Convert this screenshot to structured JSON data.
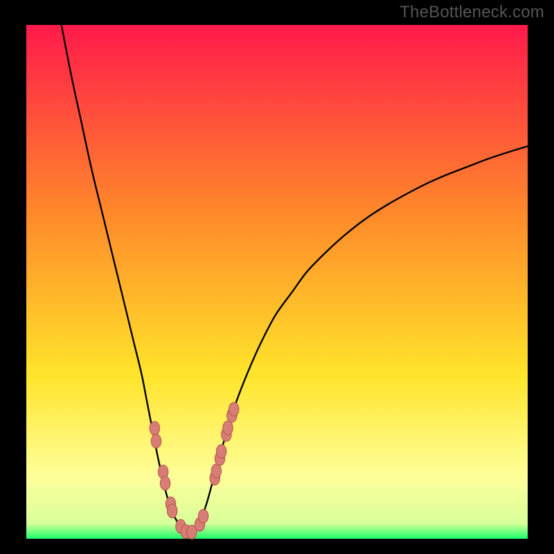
{
  "attribution": "TheBottleneck.com",
  "colors": {
    "frame": "#000000",
    "gradient_top": "#ff1a4b",
    "gradient_mid1": "#ff8a2a",
    "gradient_mid2": "#ffe42a",
    "gradient_mid3": "#ffff9a",
    "gradient_bottom": "#1cff6a",
    "curve": "#000000",
    "marker_fill": "#d77d75",
    "marker_stroke": "#b3554c"
  },
  "chart_data": {
    "type": "line",
    "title": "",
    "xlabel": "",
    "ylabel": "",
    "xlim": [
      0,
      100
    ],
    "ylim": [
      0,
      100
    ],
    "series": [
      {
        "name": "left-branch",
        "x": [
          7,
          9,
          11,
          13,
          15,
          17,
          18.5,
          20,
          21.5,
          23,
          24,
          25,
          26,
          27,
          28,
          29,
          30,
          31,
          32
        ],
        "values": [
          100,
          90,
          81,
          72,
          64,
          56,
          50,
          44,
          38,
          32,
          27,
          22,
          17,
          12.5,
          8.5,
          5.5,
          3.5,
          2,
          1.3
        ]
      },
      {
        "name": "right-branch",
        "x": [
          32,
          33,
          34,
          35,
          36,
          37,
          38,
          39,
          40,
          41,
          42,
          44,
          46,
          48,
          50,
          53,
          56,
          60,
          64,
          68,
          72,
          76,
          80,
          84,
          88,
          92,
          96,
          100
        ],
        "values": [
          1.3,
          1.4,
          2.2,
          4.2,
          7,
          10.5,
          14,
          17.5,
          21,
          24,
          27,
          32,
          36.5,
          40.5,
          44,
          48,
          52,
          56,
          59.5,
          62.5,
          65,
          67.2,
          69.2,
          70.9,
          72.4,
          73.9,
          75.2,
          76.4
        ]
      }
    ],
    "markers": [
      {
        "x": 25.6,
        "y": 21.5
      },
      {
        "x": 25.9,
        "y": 19.0
      },
      {
        "x": 27.3,
        "y": 13.0
      },
      {
        "x": 27.7,
        "y": 10.8
      },
      {
        "x": 28.8,
        "y": 6.8
      },
      {
        "x": 29.1,
        "y": 5.4
      },
      {
        "x": 30.8,
        "y": 2.4
      },
      {
        "x": 31.8,
        "y": 1.4
      },
      {
        "x": 33.0,
        "y": 1.3
      },
      {
        "x": 34.6,
        "y": 2.8
      },
      {
        "x": 35.3,
        "y": 4.4
      },
      {
        "x": 37.6,
        "y": 11.8
      },
      {
        "x": 37.9,
        "y": 13.2
      },
      {
        "x": 38.6,
        "y": 15.6
      },
      {
        "x": 38.9,
        "y": 17.0
      },
      {
        "x": 39.9,
        "y": 20.3
      },
      {
        "x": 40.2,
        "y": 21.6
      },
      {
        "x": 41.0,
        "y": 24.0
      },
      {
        "x": 41.4,
        "y": 25.2
      }
    ],
    "marker_rx": 1.0,
    "marker_ry": 1.35
  }
}
